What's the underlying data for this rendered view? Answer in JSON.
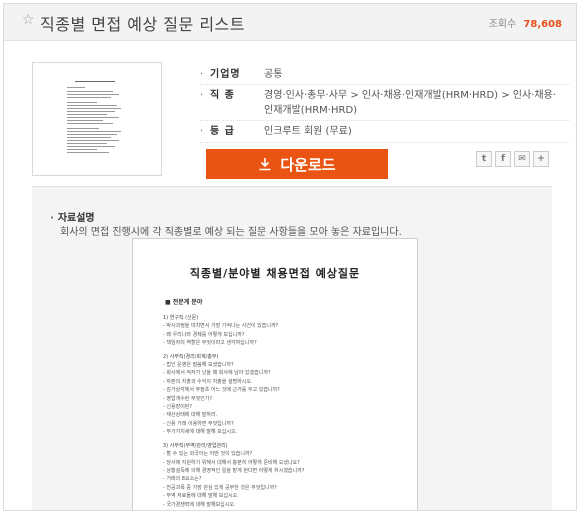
{
  "header": {
    "title": "직종별 면접 예상 질문 리스트",
    "views_label": "조회수",
    "views_count": "78,608"
  },
  "info": {
    "company_label": "기업명",
    "company_value": "공통",
    "job_label": "직 종",
    "job_value": "경영·인사·총무·사무 > 인사·채용·인재개발(HRM·HRD) > 인사·채용·인재개발(HRM·HRD)",
    "grade_label": "등 급",
    "grade_value": "인크루트 회원 (무료)"
  },
  "download": {
    "label": "다운로드"
  },
  "share": {
    "twitter": "t",
    "facebook": "f",
    "email": "✉",
    "more": "+"
  },
  "description": {
    "heading": "자료설명",
    "text": "회사의 면접 진행시에 각 직종별로 예상 되는 질문 사항들을 모아 놓은 자료입니다."
  },
  "doc_preview": {
    "title": "직종별/분야별 채용면접 예상질문",
    "section": "■ 전문계 분야",
    "lines": [
      "1) 연구직 (신문)",
      "- 박사과정을 마치면서 가장 기억나는 사건이 있습니까?",
      "- 왜 우리나라 경제를 어떻게 보십니까?",
      "- 책임자의 역할은 무엇이라고 생각하십니까?",
      "2) 사무직(경리/회계/총무)",
      "- 법인 운영은 말씀해 보셨습니까?",
      "- 회사에서 적자가 났을 때 회사에 남아 있겠습니까?",
      "- 자본의 지출과 수익의 지출을 설명하시오.",
      "- 감가상각에서 주정초 어느 것에 근거를 두고 있습니까?",
      "- 영업개수란 무엇인가?",
      "- 신용장이란?",
      "- 재산상태에 대해 말하라.",
      "- 신용 거래 이용하면 무엇입니까?",
      "- 부가가치세에 대해 말해 보십시오.",
      "3) 사무직(무역/관리/영업관리)",
      "- 할 수 있는 외국어는 어떤 것이 있습니까?",
      "- 당사에 지원하기 위해서 대해서 충분히 어떻게 준비해 오셨나요?",
      "- 상황설득에 의해 경영적인 일을 맡게 된다면 어떻게 하시겠습니까?",
      "- 거래의 8요소는?",
      "- 전공과목 중 가장 관심 있게 공부한 것은 무엇입니까?",
      "- 무역 자료들에 대해 말해 보십시오.",
      "- 국가경쟁력에 대해 말해보십시오."
    ]
  }
}
